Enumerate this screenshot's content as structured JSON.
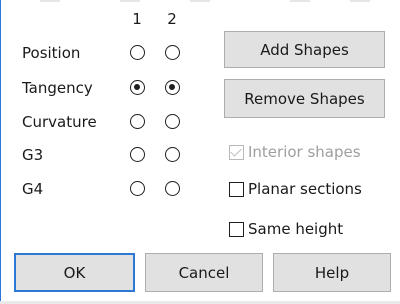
{
  "columns": [
    "1",
    "2"
  ],
  "rows": [
    {
      "label": "Position",
      "c1": false,
      "c2": false
    },
    {
      "label": "Tangency",
      "c1": true,
      "c2": true
    },
    {
      "label": "Curvature",
      "c1": false,
      "c2": false
    },
    {
      "label": "G3",
      "c1": false,
      "c2": false
    },
    {
      "label": "G4",
      "c1": false,
      "c2": false
    }
  ],
  "buttons": {
    "add_shapes": "Add Shapes",
    "remove_shapes": "Remove Shapes",
    "ok": "OK",
    "cancel": "Cancel",
    "help": "Help"
  },
  "options": {
    "interior_shapes": {
      "label": "Interior shapes",
      "checked": true,
      "enabled": false
    },
    "planar_sections": {
      "label": "Planar sections",
      "checked": false,
      "enabled": true
    },
    "same_height": {
      "label": "Same height",
      "checked": false,
      "enabled": true
    }
  }
}
